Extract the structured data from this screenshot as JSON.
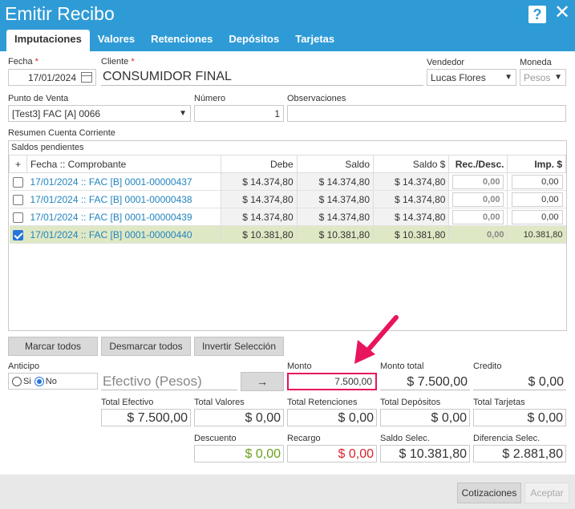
{
  "window": {
    "title": "Emitir Recibo",
    "help": "?",
    "close": "✕"
  },
  "tabs": [
    "Imputaciones",
    "Valores",
    "Retenciones",
    "Depósitos",
    "Tarjetas"
  ],
  "form": {
    "fecha_label": "Fecha",
    "fecha": "17/01/2024",
    "cliente_label": "Cliente",
    "cliente": "CONSUMIDOR FINAL",
    "vendedor_label": "Vendedor",
    "vendedor": "Lucas Flores",
    "moneda_label": "Moneda",
    "moneda": "Pesos",
    "pv_label": "Punto de Venta",
    "pv": "[Test3] FAC [A] 0066",
    "numero_label": "Número",
    "numero": "1",
    "obs_label": "Observaciones",
    "obs": "",
    "required_mark": "*"
  },
  "resumen_label": "Resumen Cuenta Corriente",
  "grid": {
    "title": "Saldos pendientes",
    "headers": [
      "+",
      "Fecha :: Comprobante",
      "Debe",
      "Saldo",
      "Saldo $",
      "Rec./Desc.",
      "Imp. $"
    ],
    "rows": [
      {
        "comprobante": "17/01/2024 :: FAC [B] 0001-00000437",
        "debe": "$ 14.374,80",
        "saldo": "$ 14.374,80",
        "saldo_pesos": "$ 14.374,80",
        "rec": "0,00",
        "imp": "0,00"
      },
      {
        "comprobante": "17/01/2024 :: FAC [B] 0001-00000438",
        "debe": "$ 14.374,80",
        "saldo": "$ 14.374,80",
        "saldo_pesos": "$ 14.374,80",
        "rec": "0,00",
        "imp": "0,00"
      },
      {
        "comprobante": "17/01/2024 :: FAC [B] 0001-00000439",
        "debe": "$ 14.374,80",
        "saldo": "$ 14.374,80",
        "saldo_pesos": "$ 14.374,80",
        "rec": "0,00",
        "imp": "0,00"
      },
      {
        "comprobante": "17/01/2024 :: FAC [B] 0001-00000440",
        "debe": "$ 10.381,80",
        "saldo": "$ 10.381,80",
        "saldo_pesos": "$ 10.381,80",
        "rec": "0,00",
        "imp": "10.381,80"
      }
    ]
  },
  "buttons": {
    "marcar": "Marcar todos",
    "desmarcar": "Desmarcar todos",
    "invertir": "Invertir Selección",
    "arrow": "→",
    "cotizaciones": "Cotizaciones",
    "aceptar": "Aceptar"
  },
  "anticipo": {
    "label": "Anticipo",
    "si": "Si",
    "no": "No"
  },
  "medio": "Efectivo (Pesos)",
  "monto": {
    "label": "Monto",
    "value": "7.500,00"
  },
  "monto_total": {
    "label": "Monto total",
    "value": "$ 7.500,00"
  },
  "credito": {
    "label": "Credito",
    "value": "$ 0,00"
  },
  "totales": {
    "efectivo_label": "Total Efectivo",
    "efectivo": "$ 7.500,00",
    "valores_label": "Total Valores",
    "valores": "$ 0,00",
    "retenciones_label": "Total Retenciones",
    "retenciones": "$ 0,00",
    "depositos_label": "Total Depósitos",
    "depositos": "$ 0,00",
    "tarjetas_label": "Total Tarjetas",
    "tarjetas": "$ 0,00"
  },
  "ajustes": {
    "descuento_label": "Descuento",
    "descuento": "$ 0,00",
    "recargo_label": "Recargo",
    "recargo": "$ 0,00",
    "saldo_label": "Saldo Selec.",
    "saldo": "$ 10.381,80",
    "diferencia_label": "Diferencia Selec.",
    "diferencia": "$ 2.881,80"
  },
  "colors": {
    "titlebar": "#2f9bd6",
    "highlight": "#e8145e",
    "descuento": "#6aa01c",
    "recargo": "#d9232d"
  }
}
